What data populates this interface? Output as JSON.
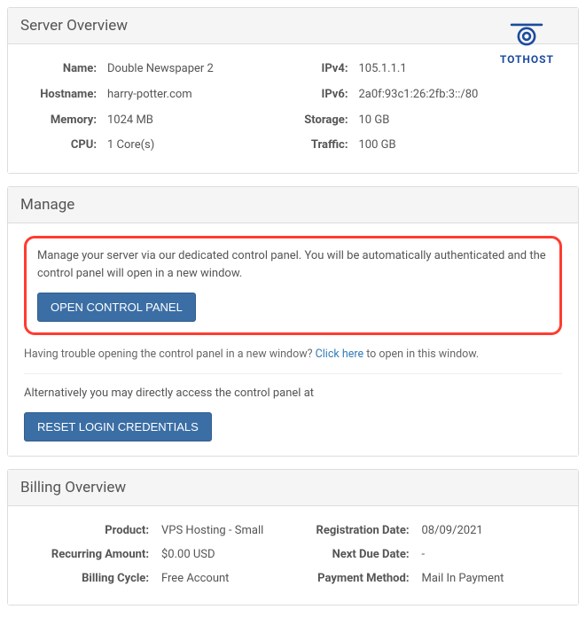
{
  "logo": {
    "name": "TOTHOST"
  },
  "server_overview": {
    "title": "Server Overview",
    "left": {
      "name_label": "Name:",
      "name": "Double Newspaper 2",
      "hostname_label": "Hostname:",
      "hostname": "harry-potter.com",
      "memory_label": "Memory:",
      "memory": "1024 MB",
      "cpu_label": "CPU:",
      "cpu": "1 Core(s)"
    },
    "right": {
      "ipv4_label": "IPv4:",
      "ipv4": "105.1.1.1",
      "ipv6_label": "IPv6:",
      "ipv6": "2a0f:93c1:26:2fb:3::/80",
      "storage_label": "Storage:",
      "storage": "10 GB",
      "traffic_label": "Traffic:",
      "traffic": "100 GB"
    }
  },
  "manage": {
    "title": "Manage",
    "description": "Manage your server via our dedicated control panel. You will be automatically authenticated and the control panel will open in a new window.",
    "open_button": "OPEN CONTROL PANEL",
    "help_prefix": "Having trouble opening the control panel in a new window? ",
    "help_link": "Click here",
    "help_suffix": " to open in this window.",
    "alt_text": "Alternatively you may directly access the control panel at",
    "reset_button": "RESET LOGIN CREDENTIALS"
  },
  "billing": {
    "title": "Billing Overview",
    "left": {
      "product_label": "Product:",
      "product": "VPS Hosting - Small",
      "recurring_label": "Recurring Amount:",
      "recurring": "$0.00 USD",
      "cycle_label": "Billing Cycle:",
      "cycle": "Free Account"
    },
    "right": {
      "reg_label": "Registration Date:",
      "reg": "08/09/2021",
      "due_label": "Next Due Date:",
      "due": "-",
      "method_label": "Payment Method:",
      "method": "Mail In Payment"
    }
  }
}
